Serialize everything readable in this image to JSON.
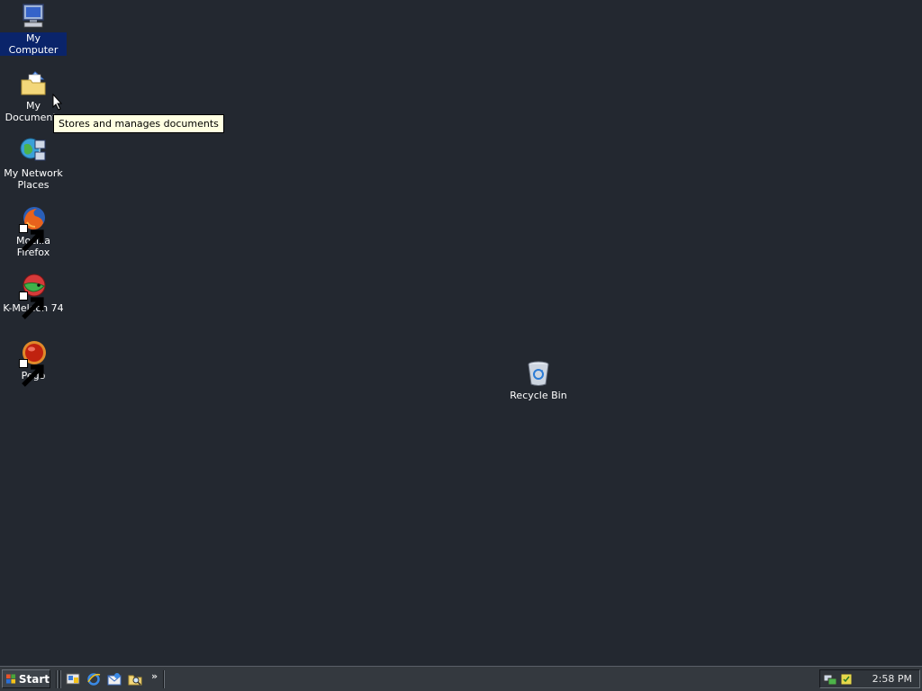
{
  "desktop": {
    "icons": [
      {
        "label": "My Computer"
      },
      {
        "label": "My Documents"
      },
      {
        "label_line1": "My Network",
        "label_line2": "Places"
      },
      {
        "label": "Mozilla Firefox"
      },
      {
        "label": "K-Meleon 74"
      },
      {
        "label": "Pego"
      },
      {
        "label": "Recycle Bin"
      }
    ],
    "tooltip": "Stores and manages documents"
  },
  "taskbar": {
    "start_label": "Start",
    "quick_launch_more": "»",
    "clock": "2:58 PM"
  },
  "colors": {
    "desktop_bg": "#232830",
    "taskbar_bg": "#34393f",
    "selection": "#0a246a",
    "tooltip_bg": "#ffffe1"
  }
}
